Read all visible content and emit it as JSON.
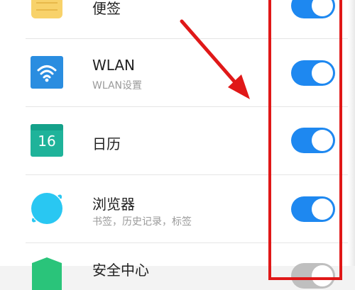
{
  "items": [
    {
      "title": "便签",
      "subtitle": "",
      "icon": "notes-icon",
      "toggle_on": true
    },
    {
      "title": "WLAN",
      "subtitle": "WLAN设置",
      "icon": "wifi-icon",
      "toggle_on": true
    },
    {
      "title": "日历",
      "subtitle": "",
      "icon": "calendar-icon",
      "calendar_day": "16",
      "toggle_on": true
    },
    {
      "title": "浏览器",
      "subtitle": "书签，历史记录，标签",
      "icon": "browser-icon",
      "toggle_on": true
    },
    {
      "title": "安全中心",
      "subtitle": "",
      "icon": "security-icon",
      "toggle_on": false
    }
  ],
  "colors": {
    "toggle_on": "#1e88f0",
    "annotation": "#e01818",
    "wifi_icon": "#2a8de0",
    "calendar_icon": "#1fb39a",
    "browser_icon": "#29c7f2",
    "notes_icon": "#f8d26a",
    "security_icon": "#2ac47a"
  }
}
